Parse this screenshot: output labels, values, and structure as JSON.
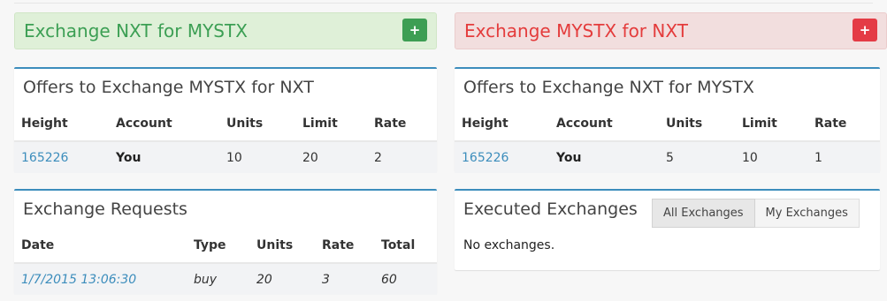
{
  "banners": {
    "left": {
      "title": "Exchange NXT for MYSTX",
      "button_icon": "plus-icon",
      "color": "#3c9f54"
    },
    "right": {
      "title": "Exchange MYSTX for NXT",
      "button_icon": "plus-icon",
      "color": "#e43c3c"
    }
  },
  "offers_mystx_for_nxt": {
    "title": "Offers to Exchange MYSTX for NXT",
    "headers": [
      "Height",
      "Account",
      "Units",
      "Limit",
      "Rate"
    ],
    "rows": [
      {
        "height": "165226",
        "account": "You",
        "units": "10",
        "limit": "20",
        "rate": "2"
      }
    ]
  },
  "offers_nxt_for_mystx": {
    "title": "Offers to Exchange NXT for MYSTX",
    "headers": [
      "Height",
      "Account",
      "Units",
      "Limit",
      "Rate"
    ],
    "rows": [
      {
        "height": "165226",
        "account": "You",
        "units": "5",
        "limit": "10",
        "rate": "1"
      }
    ]
  },
  "exchange_requests": {
    "title": "Exchange Requests",
    "headers": [
      "Date",
      "Type",
      "Units",
      "Rate",
      "Total"
    ],
    "rows": [
      {
        "date": "1/7/2015 13:06:30",
        "type": "buy",
        "units": "20",
        "rate": "3",
        "total": "60"
      }
    ]
  },
  "executed_exchanges": {
    "title": "Executed Exchanges",
    "tabs": [
      "All Exchanges",
      "My Exchanges"
    ],
    "active_tab": "All Exchanges",
    "empty_message": "No exchanges."
  },
  "colors": {
    "accent": "#3c8dbc",
    "green": "#3d9e53",
    "red": "#e43b45"
  }
}
